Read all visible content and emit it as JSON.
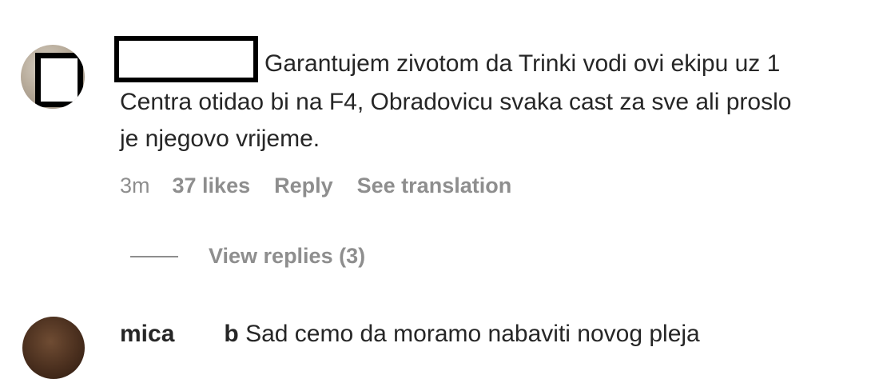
{
  "comments": [
    {
      "username_redacted": true,
      "text_lines": [
        "Garantujem zivotom da Trinki vodi ovi ekipu uz 1",
        "Centra otidao bi na F4, Obradovicu svaka cast za sve ali proslo",
        "je njegovo vrijeme."
      ],
      "time": "3m",
      "likes": "37 likes",
      "reply_label": "Reply",
      "translation_label": "See translation",
      "view_replies_label": "View replies (3)"
    },
    {
      "username_start": "mica",
      "username_end": "b",
      "text": "Sad cemo da moramo nabaviti novog pleja"
    }
  ],
  "colors": {
    "text": "#262626",
    "secondary": "#8e8e8e",
    "redaction": "#000000",
    "background": "#ffffff"
  }
}
